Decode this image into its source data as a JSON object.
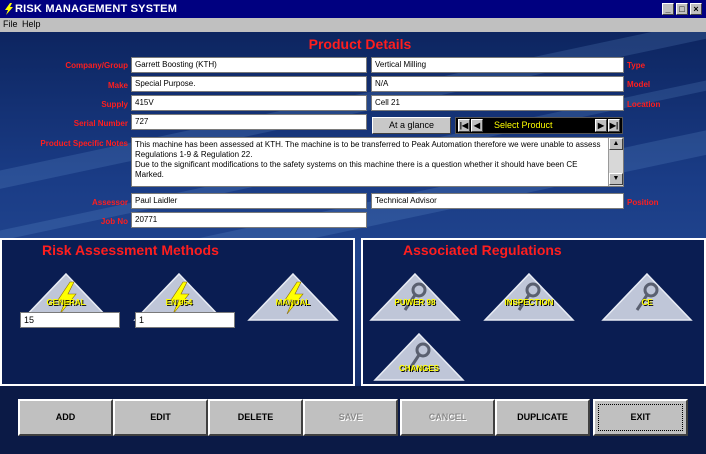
{
  "window": {
    "title": "RISK MANAGEMENT SYSTEM",
    "controls": [
      "_",
      "□",
      "×"
    ]
  },
  "menu": [
    "File",
    "Help"
  ],
  "heading": "Product Details",
  "labels": {
    "company": "Company/Group",
    "make": "Make",
    "supply": "Supply",
    "serial": "Serial Number",
    "notes": "Product Specific Notes",
    "assessor": "Assessor",
    "job": "Job No",
    "type": "Type",
    "model": "Model",
    "location": "Location",
    "position": "Position"
  },
  "fields": {
    "company": "Garrett Boosting (KTH)",
    "type": "Vertical Milling",
    "make": "Special Purpose.",
    "model": "N/A",
    "supply": "415V",
    "location": "Cell 21",
    "serial": "727",
    "assessor": "Paul Laidler",
    "position": "Technical Advisor",
    "job": "20771",
    "notes": "This machine has been assessed at KTH. The machine is to be transferred to Peak Automation therefore we were unable to assess Regulations 1-9 & Regulation 22.\nDue to the significant modifications to the safety systems on this machine there is a question whether it should have been CE Marked."
  },
  "at_a_glance": "At a glance",
  "navigator": {
    "select_product": "Select Product",
    "first": "|◀",
    "prev": "◀",
    "next": "▶",
    "last": "▶|"
  },
  "risk_methods": {
    "title": "Risk Assessment Methods",
    "items": [
      {
        "label": "GENERAL",
        "count": "15",
        "icon": "lightning-icon"
      },
      {
        "label": "EN 954",
        "count": "1",
        "icon": "lightning-icon"
      },
      {
        "label": "MANUAL",
        "icon": "lightning-icon"
      }
    ]
  },
  "regulations": {
    "title": "Associated Regulations",
    "items": [
      {
        "label": "PUWER 98",
        "icon": "wrench-icon"
      },
      {
        "label": "INSPECTION",
        "icon": "wrench-icon"
      },
      {
        "label": "CE",
        "icon": "wrench-icon"
      },
      {
        "label": "CHANGES",
        "icon": "wrench-icon"
      }
    ]
  },
  "toolbar": {
    "add": "ADD",
    "edit": "EDIT",
    "delete": "DELETE",
    "save": "SAVE",
    "cancel": "CANCEL",
    "duplicate": "DUPLICATE",
    "exit": "EXIT"
  },
  "colors": {
    "label_red": "#ff1e1e",
    "icon_yellow": "#ffff00",
    "panel_bg": "#0a1d52",
    "titlebar": "#000080"
  }
}
